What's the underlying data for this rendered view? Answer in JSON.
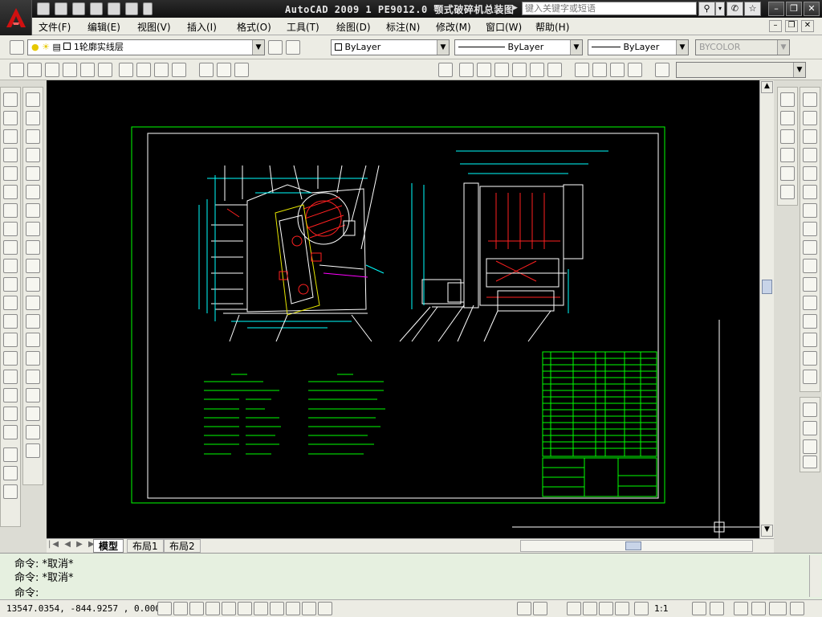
{
  "app": {
    "title": "AutoCAD 2009 1 PE9012.0 颚式破碎机总装图",
    "search_placeholder": "键入关键字或短语"
  },
  "menu": [
    "文件(F)",
    "编辑(E)",
    "视图(V)",
    "插入(I)",
    "格式(O)",
    "工具(T)",
    "绘图(D)",
    "标注(N)",
    "修改(M)",
    "窗口(W)",
    "帮助(H)"
  ],
  "layers": {
    "current_layer": "1轮廓实线层",
    "color": "ByLayer",
    "linetype": "ByLayer",
    "lineweight": "ByLayer",
    "plotstyle": "BYCOLOR"
  },
  "tabs": [
    "模型",
    "布局1",
    "布局2"
  ],
  "command": {
    "line1": "命令: *取消*",
    "line2": "命令: *取消*",
    "prompt": "命令:"
  },
  "status": {
    "coords": "13547.0354, -844.9257 , 0.0000",
    "annotation_scale": "1:1"
  },
  "colors": {
    "drawing_bg": "#000000",
    "frame": "#00ff00",
    "geometry": "#ffffff",
    "accent_red": "#ff2020",
    "accent_cyan": "#00ffff",
    "accent_magenta": "#ff00ff"
  }
}
